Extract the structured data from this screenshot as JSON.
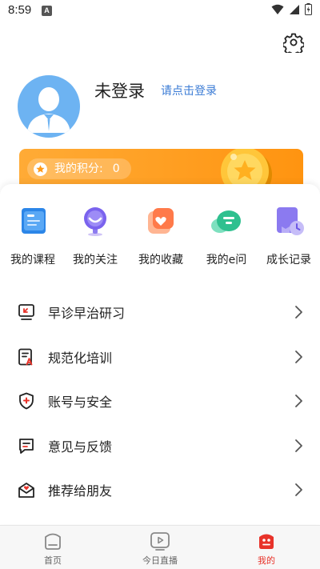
{
  "status_bar": {
    "time": "8:59",
    "notification_letter": "A"
  },
  "profile": {
    "username": "未登录",
    "login_link": "请点击登录"
  },
  "points": {
    "label": "我的积分:",
    "value": "0"
  },
  "quick_actions": [
    {
      "label": "我的课程",
      "icon": "course-icon"
    },
    {
      "label": "我的关注",
      "icon": "follow-icon"
    },
    {
      "label": "我的收藏",
      "icon": "favorites-icon"
    },
    {
      "label": "我的e问",
      "icon": "e-question-icon"
    },
    {
      "label": "成长记录",
      "icon": "growth-record-icon"
    }
  ],
  "menu": [
    {
      "label": "早诊早治研习",
      "icon": "early-diagnosis-icon"
    },
    {
      "label": "规范化培训",
      "icon": "training-icon"
    },
    {
      "label": "账号与安全",
      "icon": "security-shield-icon"
    },
    {
      "label": "意见与反馈",
      "icon": "feedback-icon"
    },
    {
      "label": "推荐给朋友",
      "icon": "recommend-icon"
    }
  ],
  "tabbar": {
    "active": "我的",
    "tabs": [
      {
        "label": "首页",
        "icon": "home-icon"
      },
      {
        "label": "今日直播",
        "icon": "live-icon"
      },
      {
        "label": "我的",
        "icon": "mine-icon"
      }
    ]
  },
  "colors": {
    "accent_blue": "#3a7bd5",
    "points_orange": "#ff9f20",
    "active_red": "#e8332a"
  }
}
